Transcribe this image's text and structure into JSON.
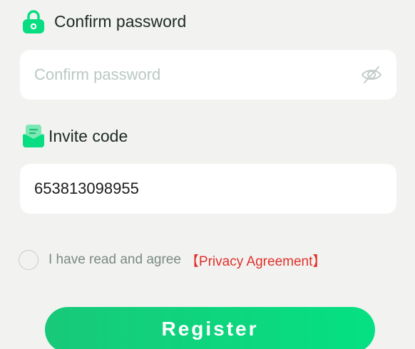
{
  "confirm_password": {
    "label": "Confirm password",
    "placeholder": "Confirm password",
    "value": "",
    "lock_icon": "lock-icon",
    "visibility_icon": "eye-off-icon"
  },
  "invite_code": {
    "label": "Invite code",
    "value": "653813098955",
    "icon": "invite-icon"
  },
  "agreement": {
    "checked": false,
    "text": "I have read and agree",
    "link": "【Privacy Agreement】"
  },
  "register": {
    "label": "Register"
  },
  "colors": {
    "accent": "#08dd82",
    "link": "#e0312b",
    "background": "#f2f2f0"
  }
}
